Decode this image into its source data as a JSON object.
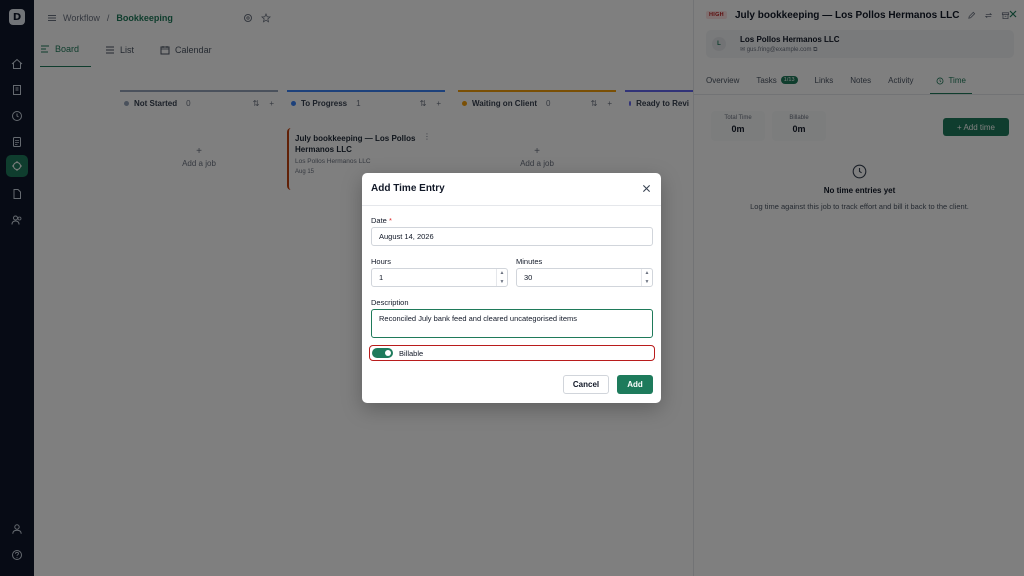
{
  "app": {
    "logo": "D"
  },
  "breadcrumb": {
    "parent": "Workflow",
    "separator": "/",
    "current": "Bookkeeping"
  },
  "views": [
    {
      "label": "Board",
      "icon": "board-icon",
      "active": true
    },
    {
      "label": "List",
      "icon": "list-icon",
      "active": false
    },
    {
      "label": "Calendar",
      "icon": "calendar-icon",
      "active": false
    }
  ],
  "columns": [
    {
      "name": "Not Started",
      "count": "0",
      "sort": "⇅",
      "plus": "+",
      "color": "#94a3b8",
      "add_job": "Add a job"
    },
    {
      "name": "To Progress",
      "count": "1",
      "sort": "⇅",
      "plus": "+",
      "color": "#3b82f6"
    },
    {
      "name": "Waiting on Client",
      "count": "0",
      "sort": "⇅",
      "plus": "+",
      "color": "#f59e0b",
      "add_job": "Add a job"
    },
    {
      "name": "Ready to Revi",
      "count": "",
      "color": "#6366f1"
    }
  ],
  "job_card": {
    "title": "July bookkeeping — Los Pollos Hermanos LLC",
    "client": "Los Pollos Hermanos LLC",
    "date": "Aug 15",
    "accent": "#c2410c"
  },
  "panel": {
    "badge": "HIGH",
    "title": "July bookkeeping — Los Pollos Hermanos LLC",
    "client": {
      "initial": "L",
      "name": "Los Pollos Hermanos LLC",
      "email": "gus.fring@example.com"
    },
    "tabs": [
      {
        "label": "Overview"
      },
      {
        "label": "Tasks",
        "count": "1/13"
      },
      {
        "label": "Links"
      },
      {
        "label": "Notes"
      },
      {
        "label": "Activity"
      },
      {
        "label": "Time",
        "active": true
      }
    ],
    "stats": [
      {
        "label": "Total Time",
        "value": "0m"
      },
      {
        "label": "Billable",
        "value": "0m"
      }
    ],
    "add_time": "+  Add time",
    "empty_title": "No time entries yet",
    "empty_text": "Log time against this job to track effort and bill it back to the client."
  },
  "modal": {
    "title": "Add Time Entry",
    "date": {
      "label": "Date",
      "required": "*",
      "value": "August 14, 2026"
    },
    "hours": {
      "label": "Hours",
      "value": "1"
    },
    "minutes": {
      "label": "Minutes",
      "value": "30"
    },
    "description": {
      "label": "Description",
      "value": "Reconciled July bank feed and cleared uncategorised items"
    },
    "billable": {
      "label": "Billable",
      "checked": true
    },
    "cancel": "Cancel",
    "add": "Add"
  },
  "colors": {
    "accent": "#1e7b5c",
    "danger": "#b91c1c",
    "overlay": "rgba(0,0,0,0.5)"
  }
}
